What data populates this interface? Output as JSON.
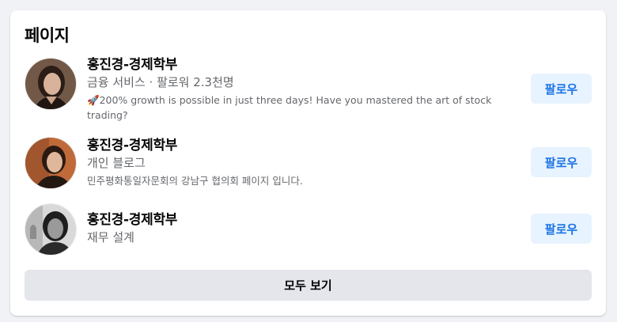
{
  "section": {
    "title": "페이지",
    "see_all_label": "모두 보기"
  },
  "pages": [
    {
      "name": "홍진경-경제학부",
      "meta": "금융 서비스 · 팔로워 2.3천명",
      "description": "🚀200% growth is possible in just three days! Have you mastered the art of stock trading?",
      "follow_label": "팔로우"
    },
    {
      "name": "홍진경-경제학부",
      "meta": "개인 블로그",
      "description": "민주평화통일자문회의 강남구 협의회 페이지 입니다.",
      "follow_label": "팔로우"
    },
    {
      "name": "홍진경-경제학부",
      "meta": "재무 설계",
      "description": "",
      "follow_label": "팔로우"
    }
  ],
  "colors": {
    "follow_text": "#1b74e4",
    "follow_bg": "#e7f3ff",
    "secondary_text": "#65676b",
    "page_bg": "#f0f2f5"
  }
}
